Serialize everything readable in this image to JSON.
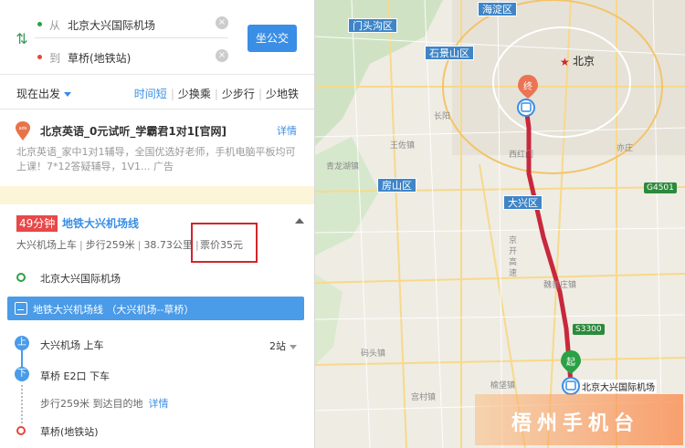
{
  "route": {
    "from_prefix": "从",
    "from_value": "北京大兴国际机场",
    "to_prefix": "到",
    "to_value": "草桥(地铁站)",
    "search_button": "坐公交"
  },
  "filter": {
    "depart": "现在出发",
    "options": [
      "时间短",
      "少换乘",
      "少步行",
      "少地铁"
    ],
    "active": "时间短"
  },
  "ad": {
    "title": "北京英语_0元试听_学霸君1对1[官网]",
    "detail": "详情",
    "desc": "北京英语_家中1对1辅导，全国优选好老师，手机电脑平板均可上课！7*12答疑辅导，1V1... 广告"
  },
  "plan": {
    "time": "49分钟",
    "line_name": "地铁大兴机场线",
    "board": "大兴机场上车",
    "walk_short": "步行259米",
    "distance": "38.73公里",
    "fare": "票价35元",
    "start_stop": "北京大兴国际机场",
    "line_bar": "地铁大兴机场线 （大兴机场--草桥）",
    "up_icon": "上",
    "down_icon": "下",
    "board_step": "大兴机场 上车",
    "stations": "2站",
    "alight_step": "草桥 E2口 下车",
    "walk_step": "步行259米 到达目的地",
    "walk_link": "详情",
    "end_stop": "草桥(地铁站)"
  },
  "map": {
    "districts": [
      "海淀区",
      "门头沟区",
      "石景山区",
      "房山区",
      "大兴区"
    ],
    "city": "北京",
    "towns": [
      "王佐镇",
      "西红门",
      "青龙湖镇",
      "魏善庄镇",
      "榆垡镇",
      "宫村镇",
      "码头镇",
      "长阳",
      "亦庄"
    ],
    "roads": [
      "G4501",
      "S3300"
    ],
    "roads_vertical": [
      "京",
      "开",
      "高",
      "速"
    ],
    "end_marker": "终",
    "start_marker": "起",
    "airport_label": "北京大兴国际机场",
    "route_color": "#c8283c"
  },
  "watermark": "梧州手机台"
}
